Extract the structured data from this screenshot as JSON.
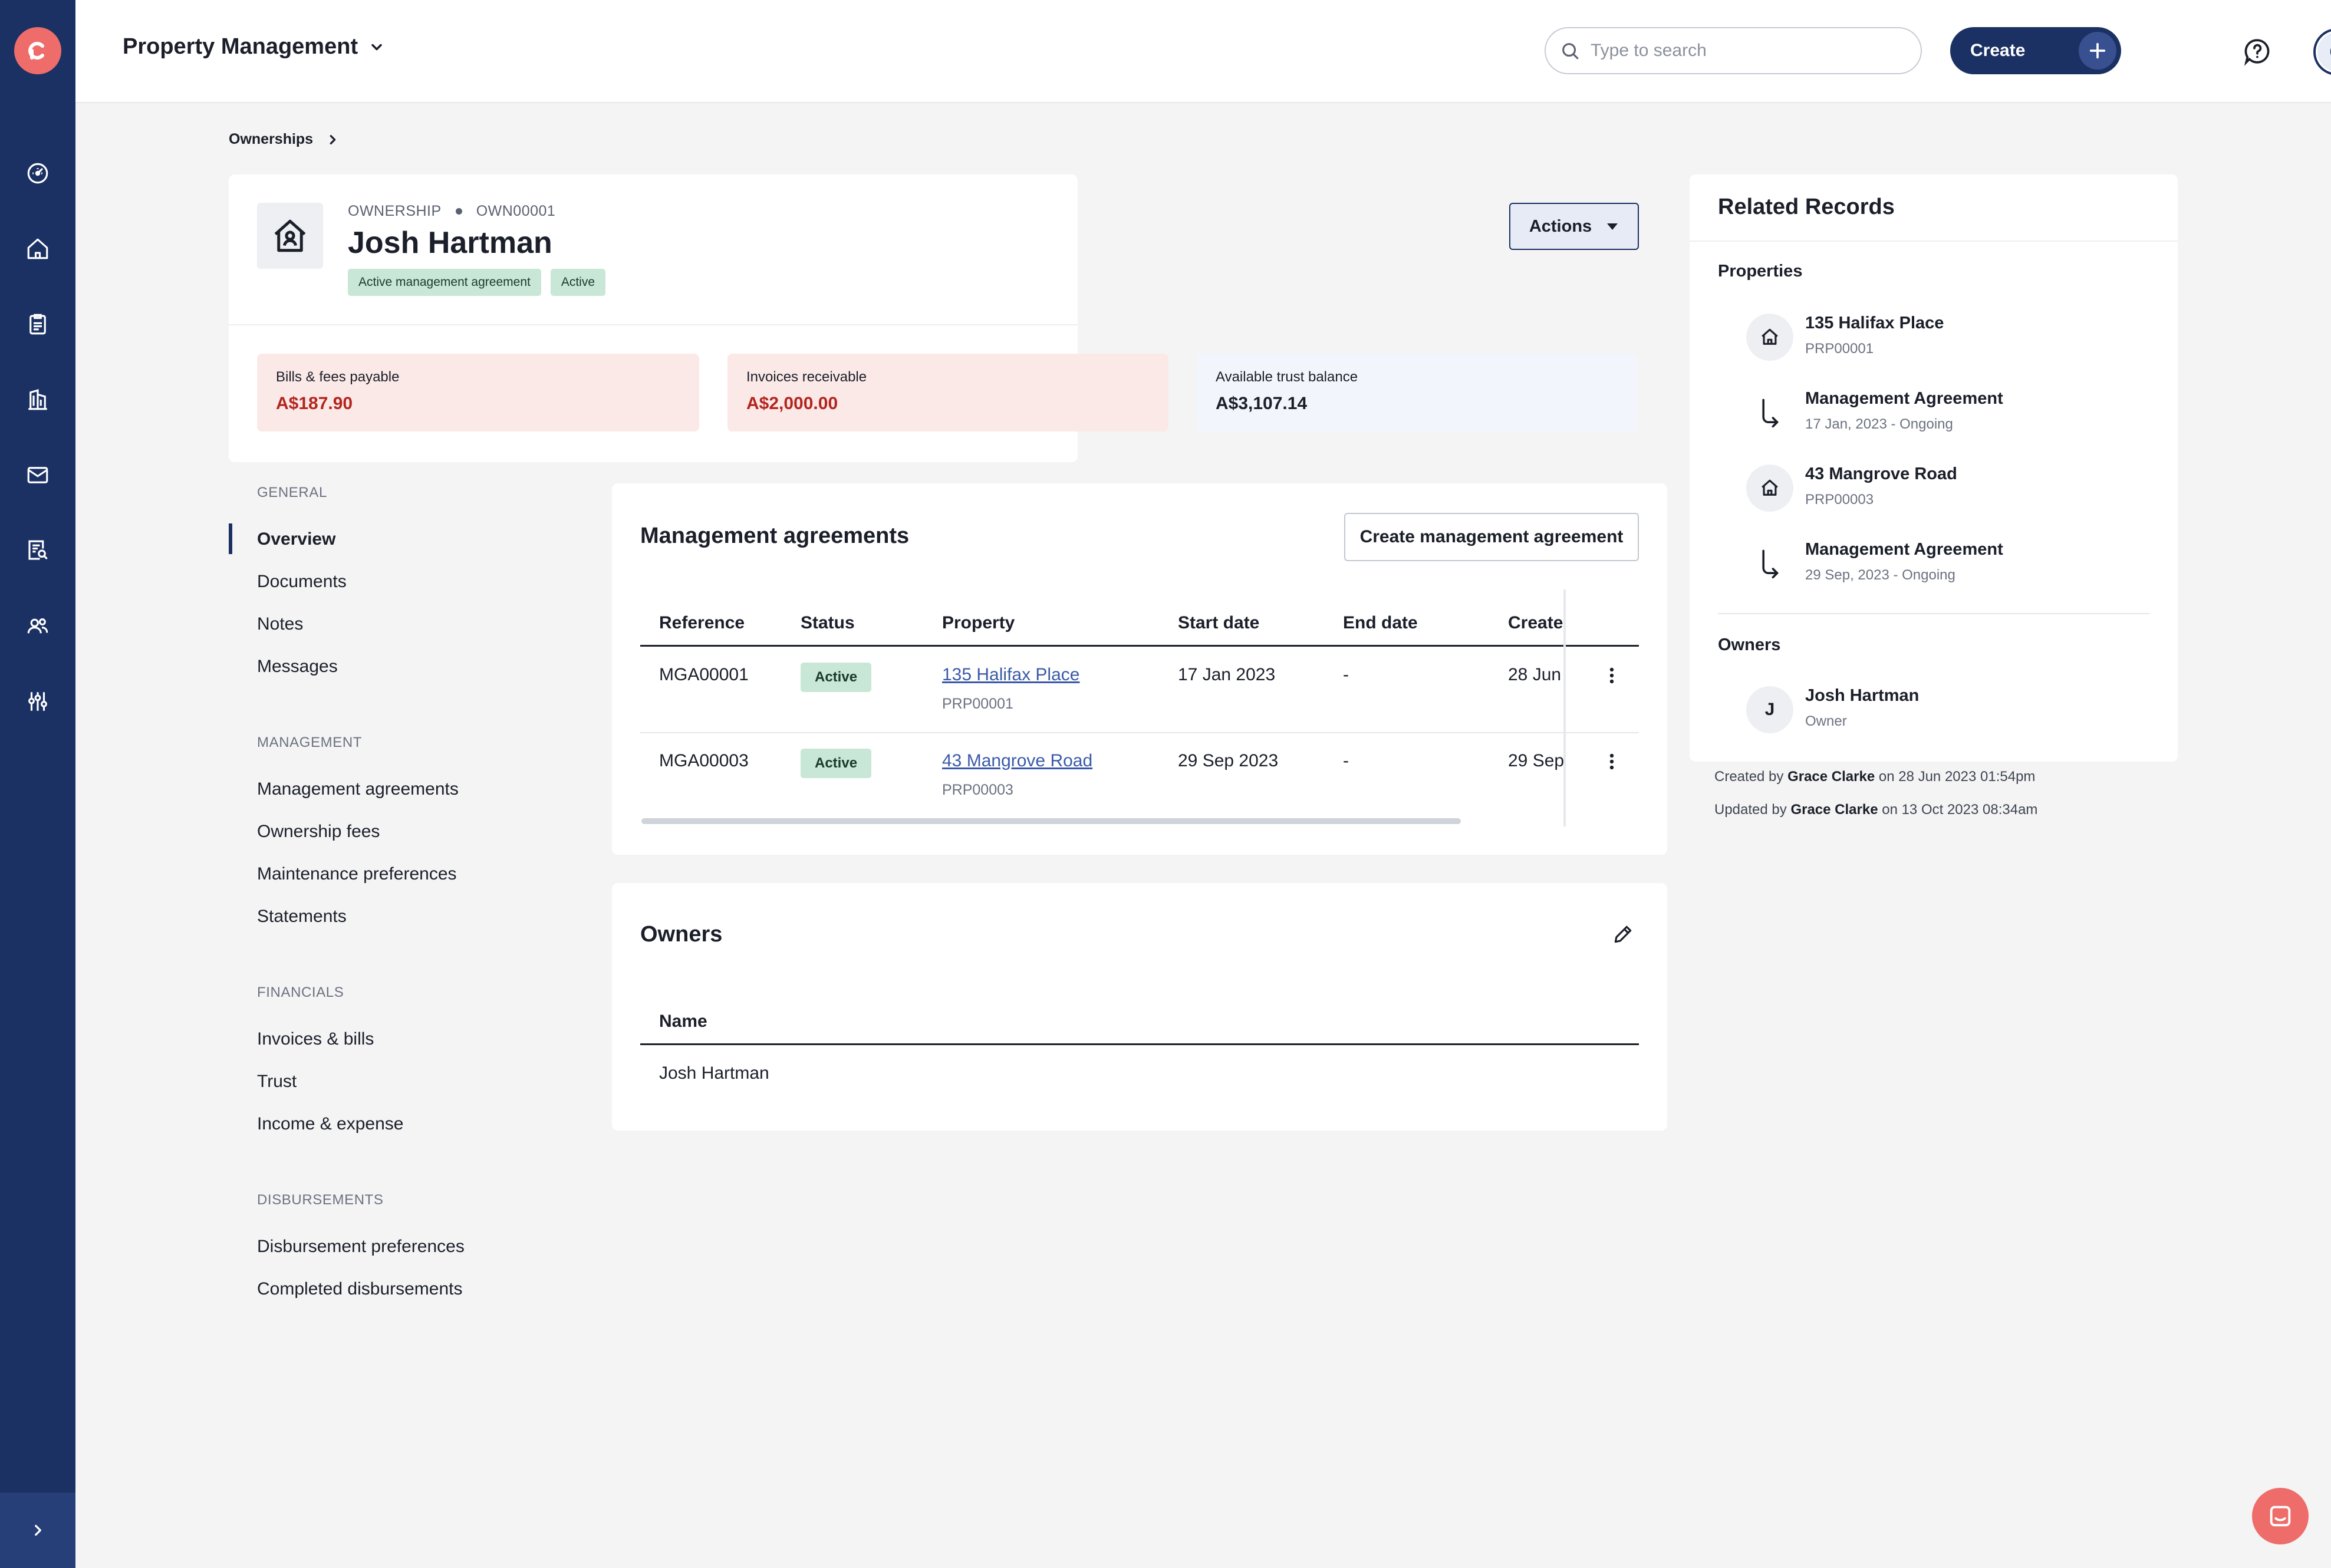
{
  "app": {
    "title": "Property Management"
  },
  "search": {
    "placeholder": "Type to search",
    "value": ""
  },
  "create_label": "Create",
  "user": {
    "initial": "G"
  },
  "breadcrumb": {
    "label": "Ownerships"
  },
  "ownership": {
    "type_label": "OWNERSHIP",
    "id": "OWN00001",
    "name": "Josh Hartman",
    "badges": [
      "Active management agreement",
      "Active"
    ],
    "actions_label": "Actions"
  },
  "stats": [
    {
      "label": "Bills & fees payable",
      "value": "A$187.90",
      "tone": "negative"
    },
    {
      "label": "Invoices receivable",
      "value": "A$2,000.00",
      "tone": "negative"
    },
    {
      "label": "Available trust balance",
      "value": "A$3,107.14",
      "tone": "neutral"
    }
  ],
  "colors": {
    "rail": "#1b3163",
    "accent": "#ee6d6a",
    "negative_bg": "#fbe9e8",
    "negative_text": "#b3261e",
    "neutral_bg": "#f2f5fb",
    "badge_bg": "#c9e7d6",
    "link": "#3a5aa8"
  },
  "sections": {
    "general": {
      "heading": "GENERAL",
      "items": [
        "Overview",
        "Documents",
        "Notes",
        "Messages"
      ],
      "active": "Overview"
    },
    "management": {
      "heading": "MANAGEMENT",
      "items": [
        "Management agreements",
        "Ownership fees",
        "Maintenance preferences",
        "Statements"
      ]
    },
    "financials": {
      "heading": "FINANCIALS",
      "items": [
        "Invoices & bills",
        "Trust",
        "Income & expense"
      ]
    },
    "disbursements": {
      "heading": "DISBURSEMENTS",
      "items": [
        "Disbursement preferences",
        "Completed disbursements"
      ]
    }
  },
  "agreements": {
    "title": "Management agreements",
    "create_label": "Create management agreement",
    "columns": [
      "Reference",
      "Status",
      "Property",
      "Start date",
      "End date",
      "Created"
    ],
    "rows": [
      {
        "reference": "MGA00001",
        "status": "Active",
        "property": "135 Halifax Place",
        "property_ref": "PRP00001",
        "start": "17 Jan 2023",
        "end": "-",
        "created": "28 Jun"
      },
      {
        "reference": "MGA00003",
        "status": "Active",
        "property": "43 Mangrove Road",
        "property_ref": "PRP00003",
        "start": "29 Sep 2023",
        "end": "-",
        "created": "29 Sep"
      }
    ]
  },
  "owners": {
    "title": "Owners",
    "column": "Name",
    "rows": [
      "Josh Hartman"
    ]
  },
  "related": {
    "title": "Related Records",
    "properties_label": "Properties",
    "items": [
      {
        "kind": "property",
        "title": "135 Halifax Place",
        "sub": "PRP00001"
      },
      {
        "kind": "agreement",
        "title": "Management Agreement",
        "sub": "17 Jan, 2023 - Ongoing"
      },
      {
        "kind": "property",
        "title": "43 Mangrove Road",
        "sub": "PRP00003"
      },
      {
        "kind": "agreement",
        "title": "Management Agreement",
        "sub": "29 Sep, 2023 - Ongoing"
      }
    ],
    "owners_label": "Owners",
    "owner": {
      "initial": "J",
      "name": "Josh Hartman",
      "role": "Owner"
    }
  },
  "audit": {
    "created_prefix": "Created by",
    "created_by": "Grace Clarke",
    "created_on": "on 28 Jun 2023 01:54pm",
    "updated_prefix": "Updated by",
    "updated_by": "Grace Clarke",
    "updated_on": "on 13 Oct 2023 08:34am"
  },
  "icons": {
    "rail": [
      "dashboard-icon",
      "home-icon",
      "clipboard-icon",
      "building-icon",
      "mail-icon",
      "report-search-icon",
      "people-icon",
      "settings-sliders-icon"
    ]
  }
}
